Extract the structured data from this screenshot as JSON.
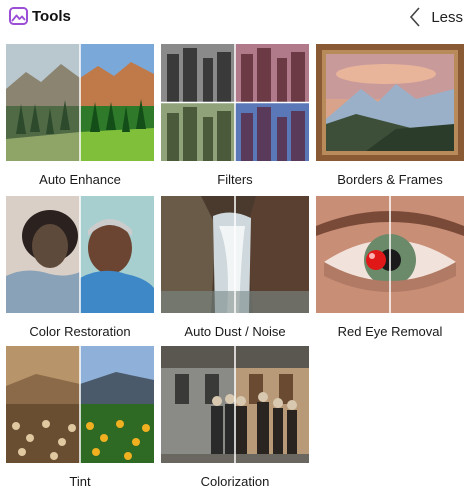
{
  "header": {
    "title": "Tools",
    "collapse_label": "Less"
  },
  "tools": [
    {
      "label": "Auto Enhance"
    },
    {
      "label": "Filters"
    },
    {
      "label": "Borders & Frames"
    },
    {
      "label": "Color Restoration"
    },
    {
      "label": "Auto Dust / Noise"
    },
    {
      "label": "Red Eye Removal"
    },
    {
      "label": "Tint"
    },
    {
      "label": "Colorization"
    }
  ],
  "colors": {
    "accent": "#9b4fd6",
    "text": "#1a1a1a"
  }
}
